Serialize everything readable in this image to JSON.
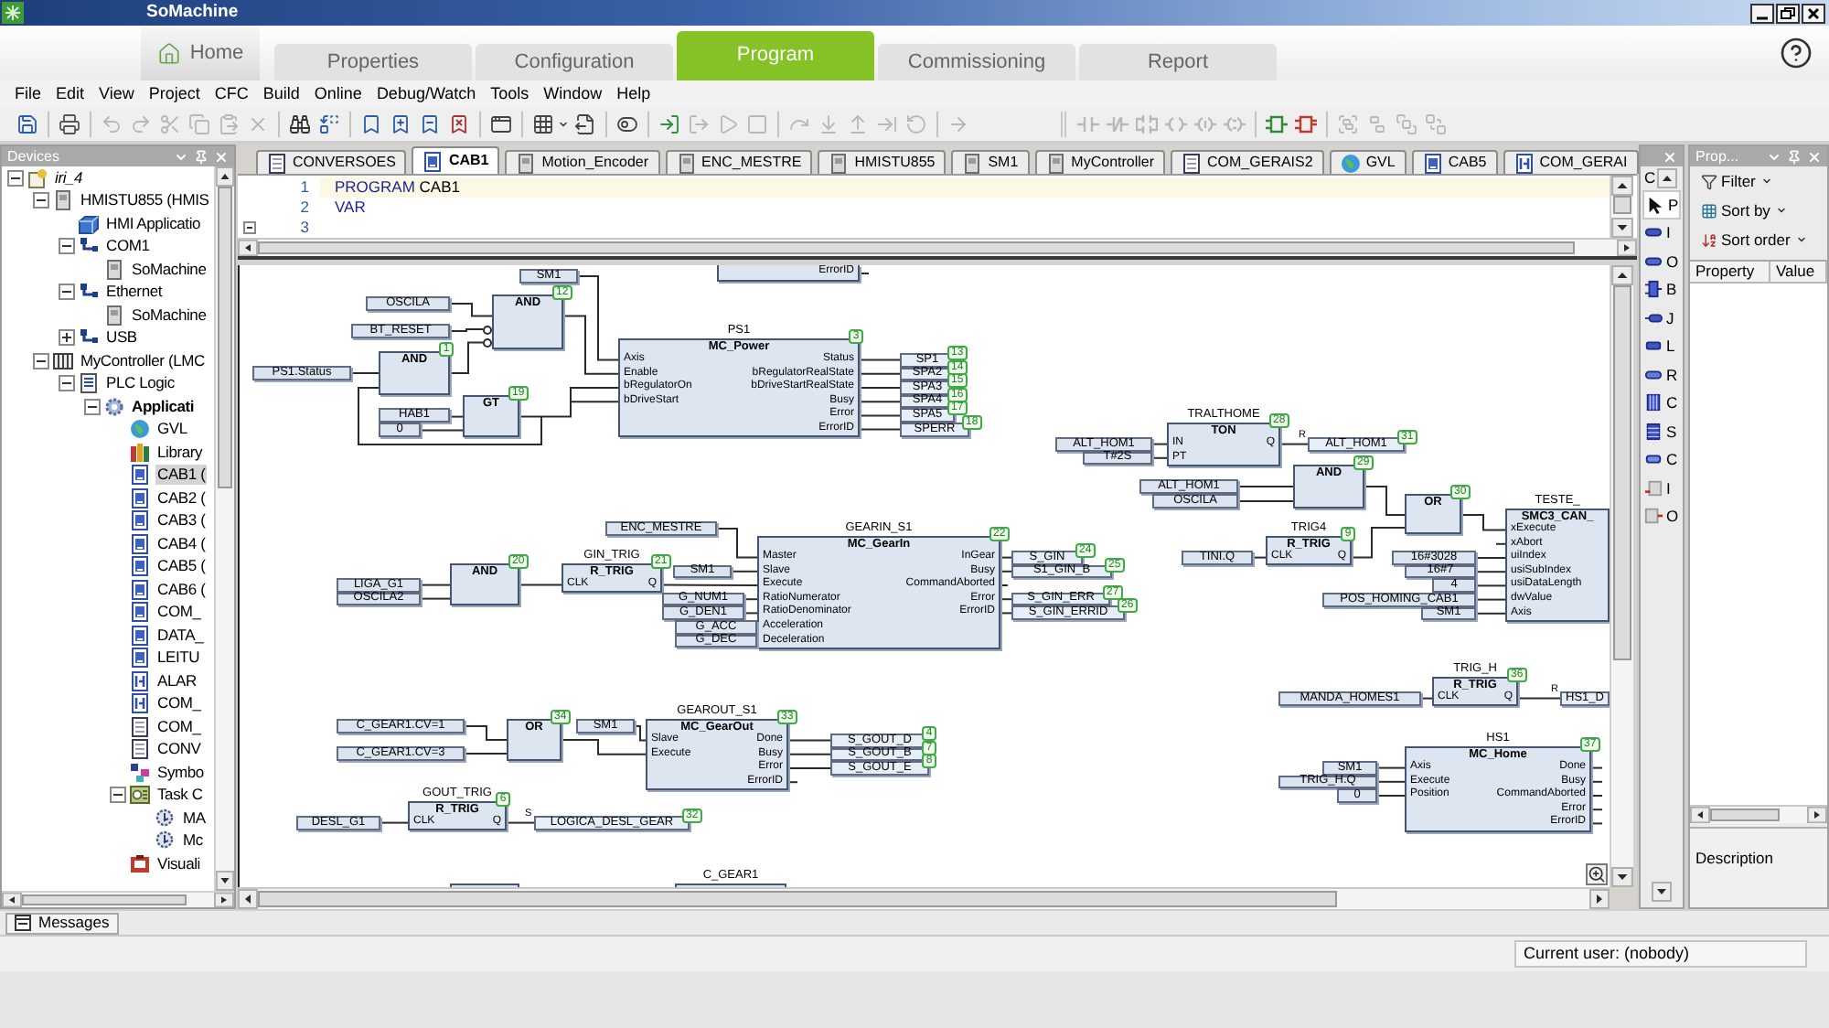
{
  "window": {
    "title": "SoMachine"
  },
  "main_tabs": [
    {
      "label": "Home",
      "kind": "home",
      "selected": false
    },
    {
      "label": "Properties",
      "kind": "step",
      "selected": false
    },
    {
      "label": "Configuration",
      "kind": "step",
      "selected": false
    },
    {
      "label": "Program",
      "kind": "step",
      "selected": true
    },
    {
      "label": "Commissioning",
      "kind": "step",
      "selected": false
    },
    {
      "label": "Report",
      "kind": "step",
      "selected": false
    }
  ],
  "menu": [
    "File",
    "Edit",
    "View",
    "Project",
    "CFC",
    "Build",
    "Online",
    "Debug/Watch",
    "Tools",
    "Window",
    "Help"
  ],
  "toolbar": [
    [
      [
        {
          "kind": "save",
          "disabled": false
        }
      ],
      [
        {
          "kind": "print",
          "disabled": false
        }
      ],
      [
        {
          "kind": "undo",
          "disabled": true
        },
        {
          "kind": "redo",
          "disabled": true
        },
        {
          "kind": "cut",
          "disabled": true
        },
        {
          "kind": "copy",
          "disabled": true
        },
        {
          "kind": "paste",
          "disabled": true
        },
        {
          "kind": "delete",
          "disabled": true
        }
      ],
      [
        {
          "kind": "find",
          "disabled": false
        },
        {
          "kind": "replace",
          "disabled": false
        }
      ],
      [
        {
          "kind": "bookmark",
          "disabled": false
        },
        {
          "kind": "bookmark_next",
          "disabled": false
        },
        {
          "kind": "bookmark_prev",
          "disabled": false
        },
        {
          "kind": "bookmark_clear",
          "disabled": false
        }
      ],
      [
        {
          "kind": "window",
          "disabled": false
        }
      ],
      [
        {
          "kind": "grid_menu",
          "disabled": false
        },
        {
          "kind": "export",
          "disabled": false
        }
      ],
      [
        {
          "kind": "toggle",
          "disabled": false
        }
      ],
      [
        {
          "kind": "login",
          "disabled": false
        },
        {
          "kind": "logout",
          "disabled": true
        },
        {
          "kind": "run",
          "disabled": true
        },
        {
          "kind": "stop",
          "disabled": true
        }
      ],
      [
        {
          "kind": "step_over",
          "disabled": true
        },
        {
          "kind": "step_into",
          "disabled": true
        },
        {
          "kind": "step_out",
          "disabled": true
        },
        {
          "kind": "run_to",
          "disabled": true
        },
        {
          "kind": "restart",
          "disabled": true
        }
      ],
      [
        {
          "kind": "next",
          "disabled": true
        }
      ]
    ],
    [
      [
        {
          "kind": "contact",
          "disabled": true
        },
        {
          "kind": "neg_contact",
          "disabled": true
        },
        {
          "kind": "par_contact",
          "disabled": true
        },
        {
          "kind": "coil",
          "disabled": true
        },
        {
          "kind": "set_coil",
          "disabled": true
        },
        {
          "kind": "reset_coil",
          "disabled": true
        }
      ],
      [
        {
          "kind": "box",
          "disabled": false
        },
        {
          "kind": "box_en",
          "disabled": false
        }
      ],
      [
        {
          "kind": "group",
          "disabled": true
        },
        {
          "kind": "ungroup",
          "disabled": true
        },
        {
          "kind": "front",
          "disabled": true
        },
        {
          "kind": "back",
          "disabled": true
        }
      ]
    ]
  ],
  "devices": {
    "title": "Devices",
    "tree": [
      {
        "label": "iri_4",
        "kind": "project",
        "expanded": true,
        "selected": false,
        "children": [
          {
            "label": "HMISTU855 (HMIS",
            "kind": "device",
            "expanded": true,
            "selected": false,
            "children": [
              {
                "label": "HMI Applicatio",
                "kind": "hmi_app",
                "selected": false
              },
              {
                "label": "COM1",
                "kind": "connector",
                "expanded": true,
                "selected": false,
                "children": [
                  {
                    "label": "SoMachine",
                    "kind": "device",
                    "selected": false
                  }
                ]
              },
              {
                "label": "Ethernet",
                "kind": "connector",
                "expanded": true,
                "selected": false,
                "children": [
                  {
                    "label": "SoMachine",
                    "kind": "device",
                    "selected": false
                  }
                ]
              },
              {
                "label": "USB",
                "kind": "connector",
                "expanded": false,
                "selected": false
              }
            ]
          },
          {
            "label": "MyController (LMC",
            "kind": "controller",
            "expanded": true,
            "selected": false,
            "children": [
              {
                "label": "PLC Logic",
                "kind": "plc_logic",
                "expanded": true,
                "selected": false,
                "children": [
                  {
                    "label": "Applicati",
                    "kind": "application",
                    "expanded": true,
                    "selected": false,
                    "children": [
                      {
                        "label": "GVL",
                        "kind": "gvl",
                        "selected": false
                      },
                      {
                        "label": "Library",
                        "kind": "library",
                        "selected": false
                      },
                      {
                        "label": "CAB1 (",
                        "kind": "pou",
                        "selected": true
                      },
                      {
                        "label": "CAB2 (",
                        "kind": "pou",
                        "selected": false
                      },
                      {
                        "label": "CAB3 (",
                        "kind": "pou",
                        "selected": false
                      },
                      {
                        "label": "CAB4 (",
                        "kind": "pou",
                        "selected": false
                      },
                      {
                        "label": "CAB5 (",
                        "kind": "pou",
                        "selected": false
                      },
                      {
                        "label": "CAB6 (",
                        "kind": "pou",
                        "selected": false
                      },
                      {
                        "label": "COM_",
                        "kind": "pou",
                        "selected": false
                      },
                      {
                        "label": "DATA_",
                        "kind": "pou",
                        "selected": false
                      },
                      {
                        "label": "LEITU",
                        "kind": "pou",
                        "selected": false
                      },
                      {
                        "label": "ALAR",
                        "kind": "list",
                        "selected": false
                      },
                      {
                        "label": "COM_",
                        "kind": "list",
                        "selected": false
                      },
                      {
                        "label": "COM_",
                        "kind": "dut",
                        "selected": false
                      },
                      {
                        "label": "CONV",
                        "kind": "dut",
                        "selected": false
                      },
                      {
                        "label": "Symbo",
                        "kind": "symbols",
                        "selected": false
                      },
                      {
                        "label": "Task C",
                        "kind": "task_config",
                        "expanded": true,
                        "selected": false,
                        "children": [
                          {
                            "label": "MA",
                            "kind": "task",
                            "selected": false
                          },
                          {
                            "label": "Mc",
                            "kind": "task",
                            "selected": false
                          }
                        ]
                      },
                      {
                        "label": "Visuali",
                        "kind": "visualization",
                        "selected": false
                      }
                    ]
                  }
                ]
              }
            ]
          }
        ]
      }
    ]
  },
  "editor": {
    "tabs": [
      {
        "label": "CONVERSOES",
        "kind": "dut",
        "selected": false
      },
      {
        "label": "CAB1",
        "kind": "pou",
        "selected": true
      },
      {
        "label": "Motion_Encoder",
        "kind": "device",
        "selected": false
      },
      {
        "label": "ENC_MESTRE",
        "kind": "device",
        "selected": false
      },
      {
        "label": "HMISTU855",
        "kind": "device",
        "selected": false
      },
      {
        "label": "SM1",
        "kind": "device",
        "selected": false
      },
      {
        "label": "MyController",
        "kind": "device",
        "selected": false
      },
      {
        "label": "COM_GERAIS2",
        "kind": "dut",
        "selected": false
      },
      {
        "label": "GVL",
        "kind": "gvl",
        "selected": false
      },
      {
        "label": "CAB5",
        "kind": "pou",
        "selected": false
      },
      {
        "label": "COM_GERAI",
        "kind": "list",
        "selected": false
      }
    ],
    "code": [
      {
        "number": "1",
        "current": true,
        "fold": false,
        "tokens": [
          {
            "text": "PROGRAM",
            "kind": "keyword"
          },
          {
            "text": "CAB1",
            "kind": "name"
          }
        ]
      },
      {
        "number": "2",
        "current": false,
        "fold": false,
        "tokens": [
          {
            "text": "VAR",
            "kind": "keyword"
          }
        ]
      },
      {
        "number": "3",
        "current": false,
        "fold": true
      }
    ],
    "diagram": {
      "blocks": [
        {
          "kind": "cut_top",
          "outputs": [
            {
              "label": "ErrorID"
            }
          ]
        },
        {
          "kind": "operator",
          "type": "AND",
          "order": "12",
          "inputs": [
            {
              "negated": false
            },
            {
              "negated": true
            },
            {
              "negated": true
            }
          ]
        },
        {
          "kind": "operator",
          "type": "AND",
          "order": "1",
          "inputs": [
            {
              "negated": false
            },
            {
              "negated": false
            }
          ]
        },
        {
          "kind": "operator",
          "type": "GT",
          "order": "19",
          "inputs": [
            {
              "negated": false
            },
            {
              "negated": false
            }
          ]
        },
        {
          "kind": "function_block",
          "instance": "PS1",
          "type": "MC_Power",
          "order": "3",
          "inputs": [
            {
              "label": "Axis"
            },
            {
              "label": "Enable"
            },
            {
              "label": "bRegulatorOn"
            },
            {
              "label": "bDriveStart"
            }
          ],
          "outputs": [
            {
              "label": "Status"
            },
            {
              "label": "bRegulatorRealState"
            },
            {
              "label": "bDriveStartRealState"
            },
            {
              "label": "Busy"
            },
            {
              "label": "Error"
            },
            {
              "label": "ErrorID"
            }
          ]
        },
        {
          "kind": "function_block",
          "instance": "TRALTHOME",
          "type": "TON",
          "order": "28",
          "inputs": [
            {
              "label": "IN"
            },
            {
              "label": "PT"
            }
          ],
          "outputs": [
            {
              "label": "Q"
            }
          ]
        },
        {
          "kind": "operator",
          "type": "AND",
          "order": "29",
          "inputs": [
            {
              "negated": false
            },
            {
              "negated": false
            }
          ]
        },
        {
          "kind": "operator",
          "type": "OR",
          "order": "30",
          "inputs": [
            {
              "negated": false
            },
            {
              "negated": false
            }
          ]
        },
        {
          "kind": "operator",
          "type": "AND",
          "order": "20",
          "inputs": [
            {
              "negated": false
            },
            {
              "negated": false
            }
          ]
        },
        {
          "kind": "function_block",
          "instance": "GIN_TRIG",
          "type": "R_TRIG",
          "order": "21",
          "inputs": [
            {
              "label": "CLK"
            }
          ],
          "outputs": [
            {
              "label": "Q"
            }
          ]
        },
        {
          "kind": "function_block",
          "instance": "GEARIN_S1",
          "type": "MC_GearIn",
          "order": "22",
          "inputs": [
            {
              "label": "Master"
            },
            {
              "label": "Slave"
            },
            {
              "label": "Execute"
            },
            {
              "label": "RatioNumerator"
            },
            {
              "label": "RatioDenominator"
            },
            {
              "label": "Acceleration"
            },
            {
              "label": "Deceleration"
            }
          ],
          "outputs": [
            {
              "label": "InGear"
            },
            {
              "label": "Busy"
            },
            {
              "label": "CommandAborted"
            },
            {
              "label": "Error"
            },
            {
              "label": "ErrorID"
            }
          ]
        },
        {
          "kind": "function_block",
          "instance": "TRIG4",
          "type": "R_TRIG",
          "order": "9",
          "inputs": [
            {
              "label": "CLK"
            }
          ],
          "outputs": [
            {
              "label": "Q"
            }
          ]
        },
        {
          "kind": "function_block",
          "instance": "TESTE_",
          "type": "SMC3_CAN_",
          "inputs": [
            {
              "label": "xExecute"
            },
            {
              "label": "xAbort"
            },
            {
              "label": "uiIndex"
            },
            {
              "label": "usiSubIndex"
            },
            {
              "label": "usiDataLength"
            },
            {
              "label": "dwValue"
            },
            {
              "label": "Axis"
            }
          ]
        },
        {
          "kind": "function_block",
          "instance": "TRIG_H",
          "type": "R_TRIG",
          "order": "36",
          "inputs": [
            {
              "label": "CLK"
            }
          ],
          "outputs": [
            {
              "label": "Q"
            }
          ]
        },
        {
          "kind": "operator",
          "type": "OR",
          "order": "34",
          "inputs": [
            {
              "negated": false
            },
            {
              "negated": false
            }
          ]
        },
        {
          "kind": "function_block",
          "instance": "GEAROUT_S1",
          "type": "MC_GearOut",
          "order": "33",
          "inputs": [
            {
              "label": "Slave"
            },
            {
              "label": "Execute"
            }
          ],
          "outputs": [
            {
              "label": "Done"
            },
            {
              "label": "Busy"
            },
            {
              "label": "Error"
            },
            {
              "label": "ErrorID"
            }
          ]
        },
        {
          "kind": "function_block",
          "instance": "GOUT_TRIG",
          "type": "R_TRIG",
          "order": "6",
          "inputs": [
            {
              "label": "CLK"
            }
          ],
          "outputs": [
            {
              "label": "Q"
            }
          ]
        },
        {
          "kind": "function_block",
          "instance": "HS1",
          "type": "MC_Home",
          "order": "37",
          "inputs": [
            {
              "label": "Axis"
            },
            {
              "label": "Execute"
            },
            {
              "label": "Position"
            }
          ],
          "outputs": [
            {
              "label": "Done"
            },
            {
              "label": "Busy"
            },
            {
              "label": "CommandAborted"
            },
            {
              "label": "Error"
            },
            {
              "label": "ErrorID"
            }
          ]
        },
        {
          "kind": "cut_bottom"
        },
        {
          "kind": "cut_bottom",
          "instance": "C_GEAR1"
        }
      ],
      "variables": [
        {
          "text": "SM1",
          "kind": "input"
        },
        {
          "text": "OSCILA",
          "kind": "input"
        },
        {
          "text": "BT_RESET",
          "kind": "input"
        },
        {
          "text": "SP1",
          "kind": "output",
          "order": "13"
        },
        {
          "text": "PS1.Status",
          "kind": "input"
        },
        {
          "text": "SPA2",
          "kind": "output",
          "order": "14"
        },
        {
          "text": "SPA3",
          "kind": "output",
          "order": "15"
        },
        {
          "text": "SPA4",
          "kind": "output",
          "order": "16"
        },
        {
          "text": "HAB1",
          "kind": "input"
        },
        {
          "text": "SPA5",
          "kind": "output",
          "order": "17"
        },
        {
          "text": "0",
          "kind": "input"
        },
        {
          "text": "SPERR",
          "kind": "output",
          "order": "18"
        },
        {
          "text": "ALT_HOM1",
          "kind": "input"
        },
        {
          "text": "ALT_HOM1",
          "kind": "output",
          "order": "31",
          "set_reset": "R"
        },
        {
          "text": "T#2S",
          "kind": "input"
        },
        {
          "text": "ALT_HOM1",
          "kind": "input"
        },
        {
          "text": "OSCILA",
          "kind": "input"
        },
        {
          "text": "ENC_MESTRE",
          "kind": "input"
        },
        {
          "text": "S_GIN",
          "kind": "output",
          "order": "24"
        },
        {
          "text": "TINI.Q",
          "kind": "input"
        },
        {
          "text": "16#3028",
          "kind": "input"
        },
        {
          "text": "SM1",
          "kind": "input"
        },
        {
          "text": "S1_GIN_B",
          "kind": "output",
          "order": "25"
        },
        {
          "text": "16#7",
          "kind": "input"
        },
        {
          "text": "LIGA_G1",
          "kind": "input"
        },
        {
          "text": "4",
          "kind": "input"
        },
        {
          "text": "OSCILA2",
          "kind": "input"
        },
        {
          "text": "G_NUM1",
          "kind": "input"
        },
        {
          "text": "S_GIN_ERR",
          "kind": "output",
          "order": "27"
        },
        {
          "text": "POS_HOMING_CAB1",
          "kind": "input"
        },
        {
          "text": "G_DEN1",
          "kind": "input"
        },
        {
          "text": "S_GIN_ERRID",
          "kind": "output",
          "order": "26"
        },
        {
          "text": "SM1",
          "kind": "input"
        },
        {
          "text": "G_ACC",
          "kind": "input"
        },
        {
          "text": "G_DEC",
          "kind": "input"
        },
        {
          "text": "MANDA_HOMES1",
          "kind": "input"
        },
        {
          "text": "HS1_D",
          "kind": "output",
          "set_reset": "R"
        },
        {
          "text": "C_GEAR1.CV=1",
          "kind": "input"
        },
        {
          "text": "SM1",
          "kind": "input"
        },
        {
          "text": "S_GOUT_D",
          "kind": "output",
          "order": "4"
        },
        {
          "text": "C_GEAR1.CV=3",
          "kind": "input"
        },
        {
          "text": "S_GOUT_B",
          "kind": "output",
          "order": "7"
        },
        {
          "text": "S_GOUT_E",
          "kind": "output",
          "order": "8"
        },
        {
          "text": "SM1",
          "kind": "input"
        },
        {
          "text": "TRIG_H.Q",
          "kind": "input"
        },
        {
          "text": "0",
          "kind": "input"
        },
        {
          "text": "DESL_G1",
          "kind": "input"
        },
        {
          "text": "LOGICA_DESL_GEAR",
          "kind": "output",
          "order": "32",
          "set_reset": "S"
        }
      ]
    }
  },
  "toolbox": {
    "category": "C",
    "items": [
      {
        "label": "P",
        "kind": "pointer",
        "selected": true
      },
      {
        "label": "I",
        "kind": "input",
        "selected": false
      },
      {
        "label": "O",
        "kind": "output",
        "selected": false
      },
      {
        "label": "B",
        "kind": "box",
        "selected": false
      },
      {
        "label": "J",
        "kind": "jump",
        "selected": false
      },
      {
        "label": "L",
        "kind": "label",
        "selected": false
      },
      {
        "label": "R",
        "kind": "return",
        "selected": false
      },
      {
        "label": "C",
        "kind": "composer",
        "selected": false
      },
      {
        "label": "S",
        "kind": "selector",
        "selected": false
      },
      {
        "label": "C",
        "kind": "comment",
        "selected": false
      },
      {
        "label": "I",
        "kind": "box_input",
        "selected": false
      },
      {
        "label": "O",
        "kind": "box_output",
        "selected": false
      }
    ]
  },
  "properties": {
    "title": "Prop...",
    "actions": [
      {
        "label": "Filter",
        "kind": "filter"
      },
      {
        "label": "Sort by",
        "kind": "sort_by"
      },
      {
        "label": "Sort order",
        "kind": "sort_order"
      }
    ],
    "columns": [
      "Property",
      "Value"
    ],
    "description": "Description"
  },
  "messages": {
    "label": "Messages"
  },
  "status_bar": {
    "user": "Current user: (nobody)"
  }
}
